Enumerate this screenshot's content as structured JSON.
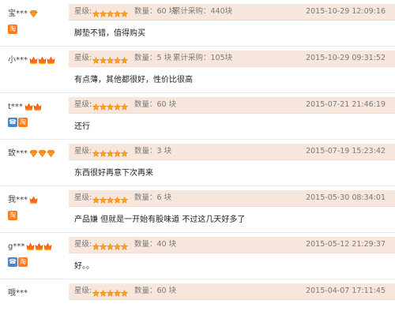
{
  "colors": {
    "accent": "#ff7a1a",
    "bar_bg": "#f7e6dc",
    "star": "#ffa020"
  },
  "labels": {
    "rating": "星级:"
  },
  "reviews": [
    {
      "user": "宝***",
      "levels": [
        "gem"
      ],
      "badges": [
        "vip"
      ],
      "qty": "数量：60 块",
      "accumulated": "累计采购：440块",
      "date": "2015-10-29 12:09:16",
      "content": "脚垫不错，值得购买"
    },
    {
      "user": "小***",
      "levels": [
        "crown",
        "crown",
        "crown"
      ],
      "badges": [],
      "qty": "数量：5 块",
      "accumulated": "累计采购：105块",
      "date": "2015-10-29 09:31:52",
      "content": "有点薄，其他都很好，性价比很高"
    },
    {
      "user": "t***",
      "levels": [
        "crown",
        "crown"
      ],
      "badges": [
        "mob",
        "vip"
      ],
      "qty": "数量：60 块",
      "accumulated": "",
      "date": "2015-07-21 21:46:19",
      "content": "还行"
    },
    {
      "user": "致***",
      "levels": [
        "gem",
        "gem",
        "gem"
      ],
      "badges": [],
      "qty": "数量：3 块",
      "accumulated": "",
      "date": "2015-07-19 15:23:42",
      "content": "东西很好再意下次再来"
    },
    {
      "user": "我***",
      "levels": [
        "crown"
      ],
      "badges": [
        "vip"
      ],
      "qty": "数量：6 块",
      "accumulated": "",
      "date": "2015-05-30 08:34:01",
      "content": "产品嫌 但就是一开始有股味道 不过这几天好多了"
    },
    {
      "user": "g***",
      "levels": [
        "crown",
        "crown",
        "crown"
      ],
      "badges": [
        "mob",
        "vip"
      ],
      "qty": "数量：40 块",
      "accumulated": "",
      "date": "2015-05-12 21:29:37",
      "content": "好。。"
    },
    {
      "user": "哦***",
      "levels": [],
      "badges": [],
      "qty": "数量：60 块",
      "accumulated": "",
      "date": "2015-04-07 17:11:45",
      "content": ""
    }
  ]
}
